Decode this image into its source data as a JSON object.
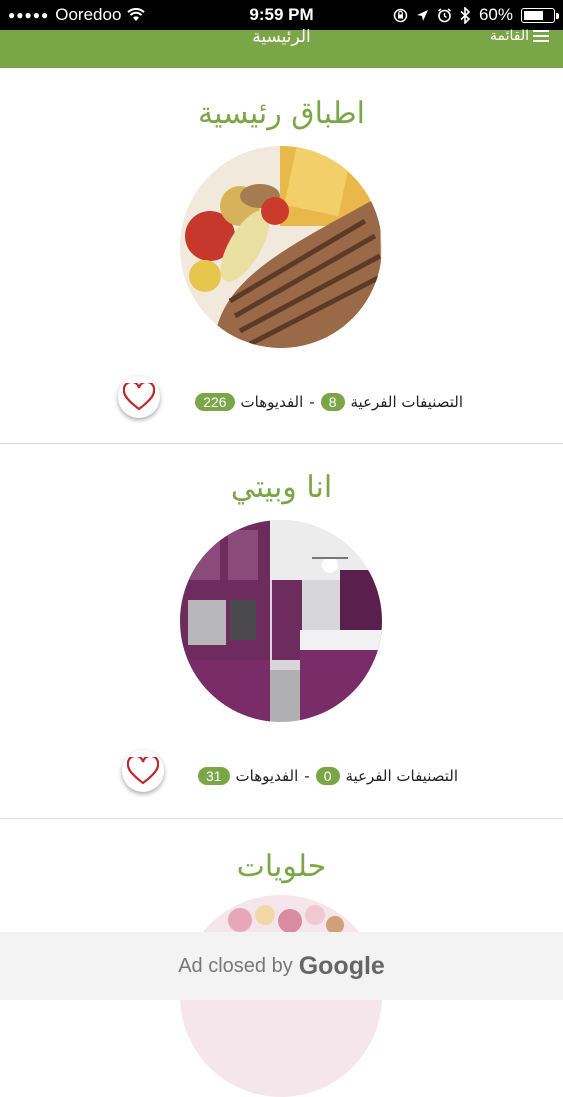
{
  "status": {
    "signal_dots": "●●●●●",
    "carrier": "Ooredoo",
    "time": "9:59 PM",
    "battery": "60%"
  },
  "nav": {
    "title": "الرئيسية",
    "menu_label": "القائمة"
  },
  "categories": [
    {
      "title": "اطباق رئيسية",
      "subcategories_label": "التصنيفات الفرعية",
      "subcategories_count": "8",
      "separator": "-",
      "videos_label": "الفديوهات",
      "videos_count": "226"
    },
    {
      "title": "انا وبيتي",
      "subcategories_label": "التصنيفات الفرعية",
      "subcategories_count": "0",
      "separator": "-",
      "videos_label": "الفديوهات",
      "videos_count": "31"
    },
    {
      "title": "حلويات"
    }
  ],
  "ad": {
    "text": "Ad closed by",
    "brand": "Google"
  },
  "colors": {
    "accent": "#7ba647",
    "heart": "#c0272d"
  }
}
